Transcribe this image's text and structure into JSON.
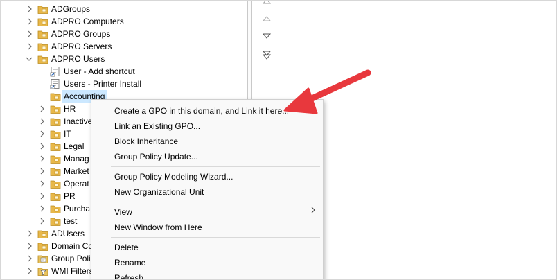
{
  "tree": {
    "items": [
      {
        "label": "ADGroups",
        "icon": "ou-folder-icon",
        "expander": "chevron-right-icon"
      },
      {
        "label": "ADPRO Computers",
        "icon": "ou-folder-icon",
        "expander": "chevron-right-icon"
      },
      {
        "label": "ADPRO Groups",
        "icon": "ou-folder-icon",
        "expander": "chevron-right-icon"
      },
      {
        "label": "ADPRO Servers",
        "icon": "ou-folder-icon",
        "expander": "chevron-right-icon"
      },
      {
        "label": "ADPRO Users",
        "icon": "ou-folder-icon",
        "expander": "chevron-down-icon"
      },
      {
        "label": "User - Add shortcut",
        "icon": "gpo-link-icon"
      },
      {
        "label": "Users - Printer Install",
        "icon": "gpo-link-icon"
      },
      {
        "label": "Accounting",
        "icon": "ou-folder-icon",
        "selected": true
      },
      {
        "label": "HR",
        "icon": "ou-folder-icon",
        "expander": "chevron-right-icon"
      },
      {
        "label": "Inactive",
        "icon": "ou-folder-icon",
        "expander": "chevron-right-icon"
      },
      {
        "label": "IT",
        "icon": "ou-folder-icon",
        "expander": "chevron-right-icon"
      },
      {
        "label": "Legal",
        "icon": "ou-folder-icon",
        "expander": "chevron-right-icon"
      },
      {
        "label": "Manag",
        "icon": "ou-folder-icon",
        "expander": "chevron-right-icon"
      },
      {
        "label": "Market",
        "icon": "ou-folder-icon",
        "expander": "chevron-right-icon"
      },
      {
        "label": "Operat",
        "icon": "ou-folder-icon",
        "expander": "chevron-right-icon"
      },
      {
        "label": "PR",
        "icon": "ou-folder-icon",
        "expander": "chevron-right-icon"
      },
      {
        "label": "Purcha",
        "icon": "ou-folder-icon",
        "expander": "chevron-right-icon"
      },
      {
        "label": "test",
        "icon": "ou-folder-icon",
        "expander": "chevron-right-icon"
      },
      {
        "label": "ADUsers",
        "icon": "ou-folder-icon",
        "expander": "chevron-right-icon"
      },
      {
        "label": "Domain Co",
        "icon": "ou-folder-icon",
        "expander": "chevron-right-icon"
      },
      {
        "label": "Group Poli",
        "icon": "gpo-folder-icon",
        "expander": "chevron-right-icon"
      },
      {
        "label": "WMI Filters",
        "icon": "wmi-folder-icon",
        "expander": "chevron-right-icon"
      }
    ]
  },
  "move_buttons": [
    "move-up-icon",
    "move-down-icon",
    "move-to-bottom-icon"
  ],
  "context_menu": {
    "items": [
      {
        "label": "Create a GPO in this domain, and Link it here..."
      },
      {
        "label": "Link an Existing GPO..."
      },
      {
        "label": "Block Inheritance"
      },
      {
        "label": "Group Policy Update..."
      },
      {
        "separator": true
      },
      {
        "label": "Group Policy Modeling Wizard..."
      },
      {
        "label": "New Organizational Unit"
      },
      {
        "separator": true
      },
      {
        "label": "View",
        "submenu": "chevron-right-icon"
      },
      {
        "label": "New Window from Here"
      },
      {
        "separator": true
      },
      {
        "label": "Delete"
      },
      {
        "label": "Rename"
      },
      {
        "label": "Refresh"
      }
    ]
  },
  "colors": {
    "selection": "#cce8ff",
    "folder": "#e8b84a",
    "annotation_arrow": "#e8383d"
  }
}
